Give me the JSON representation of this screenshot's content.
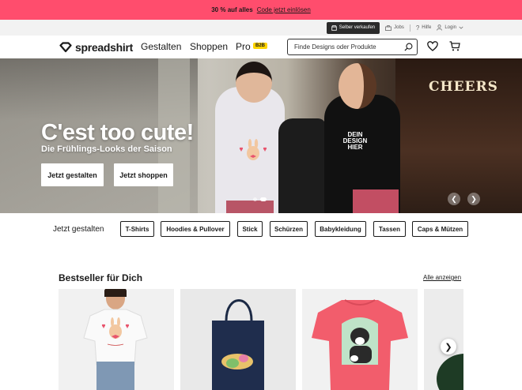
{
  "promo": {
    "text": "30 % auf alles",
    "link": "Code jetzt einlösen",
    "bg_color": "#ff4d6d"
  },
  "utility": {
    "sell_label": "Selber verkaufen",
    "jobs_label": "Jobs",
    "help_label": "Hilfe",
    "login_label": "Login"
  },
  "nav": {
    "logo": "spreadshirt",
    "links": [
      "Gestalten",
      "Shoppen",
      "Pro"
    ],
    "pro_badge": "B2B",
    "search_placeholder": "Finde Designs oder Produkte",
    "icons": [
      "search-icon",
      "heart-icon",
      "cart-icon"
    ]
  },
  "hero": {
    "title": "C'est too cute!",
    "subtitle": "Die Frühlings-Looks der Saison",
    "button_primary": "Jetzt gestalten",
    "button_secondary": "Jetzt shoppen",
    "tee_text": "DEIN DESIGN HIER",
    "sign_text": "CHEERS",
    "slide_count": 2,
    "active_slide": 2
  },
  "categories": {
    "label": "Jetzt gestalten",
    "chips": [
      "T-Shirts",
      "Hoodies & Pullover",
      "Stick",
      "Schürzen",
      "Babykleidung",
      "Tassen",
      "Caps & Mützen"
    ]
  },
  "bestseller": {
    "title": "Bestseller für Dich",
    "see_all": "Alle anzeigen",
    "products": [
      {
        "kind": "white-tshirt-bunny",
        "bg": "#f1f1f1"
      },
      {
        "kind": "navy-tote-bag",
        "bg": "#e9e9e9"
      },
      {
        "kind": "pink-tshirt-dog",
        "bg": "#f1f1f1"
      },
      {
        "kind": "green-cap",
        "bg": "#ececec"
      }
    ]
  }
}
